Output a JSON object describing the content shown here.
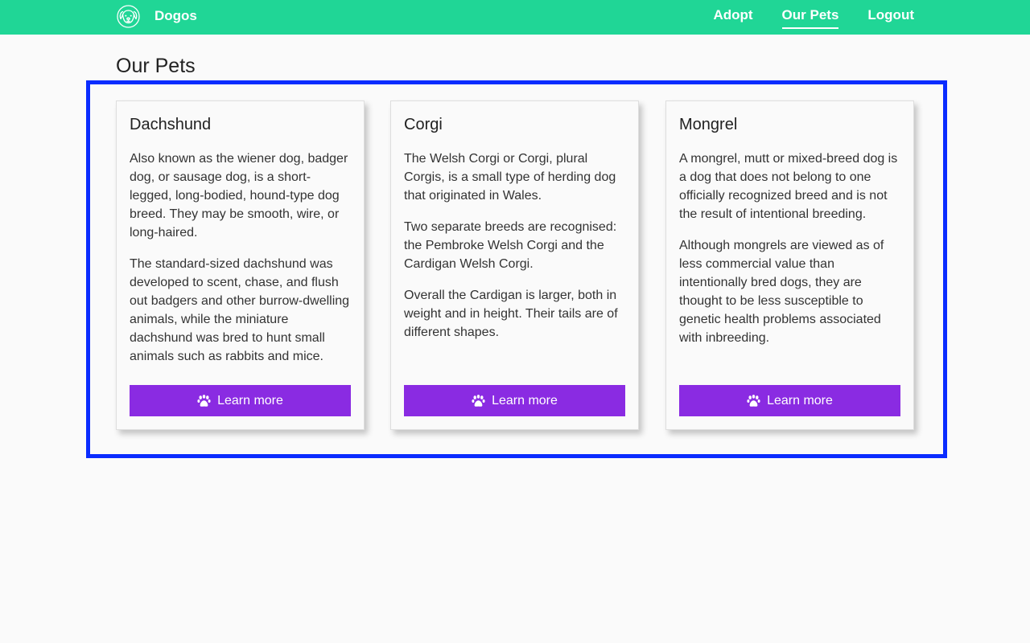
{
  "nav": {
    "brand": "Dogos",
    "links": [
      {
        "label": "Adopt"
      },
      {
        "label": "Our Pets",
        "active": true
      },
      {
        "label": "Logout"
      }
    ]
  },
  "page_title": "Our Pets",
  "cards": [
    {
      "title": "Dachshund",
      "paragraphs": [
        "Also known as the wiener dog, badger dog, or sausage dog, is a short-legged, long-bodied, hound-type dog breed. They may be smooth, wire, or long-haired.",
        "The standard-sized dachshund was developed to scent, chase, and flush out badgers and other burrow-dwelling animals, while the miniature dachshund was bred to hunt small animals such as rabbits and mice."
      ],
      "button": "Learn more"
    },
    {
      "title": "Corgi",
      "paragraphs": [
        "The Welsh Corgi or Corgi, plural Corgis, is a small type of herding dog that originated in Wales.",
        "Two separate breeds are recognised: the Pembroke Welsh Corgi and the Cardigan Welsh Corgi.",
        "Overall the Cardigan is larger, both in weight and in height. Their tails are of different shapes."
      ],
      "button": "Learn more"
    },
    {
      "title": "Mongrel",
      "paragraphs": [
        "A mongrel, mutt or mixed-breed dog is a dog that does not belong to one officially recognized breed and is not the result of intentional breeding.",
        "Although mongrels are viewed as of less commercial value than intentionally bred dogs, they are thought to be less susceptible to genetic health problems associated with inbreeding."
      ],
      "button": "Learn more"
    }
  ],
  "colors": {
    "navbar": "#20d696",
    "button": "#8a2be2",
    "highlight_border": "#0a2cff",
    "background": "#fafafa"
  },
  "icons": {
    "brand": "dog-face-icon",
    "button": "paw-icon"
  }
}
